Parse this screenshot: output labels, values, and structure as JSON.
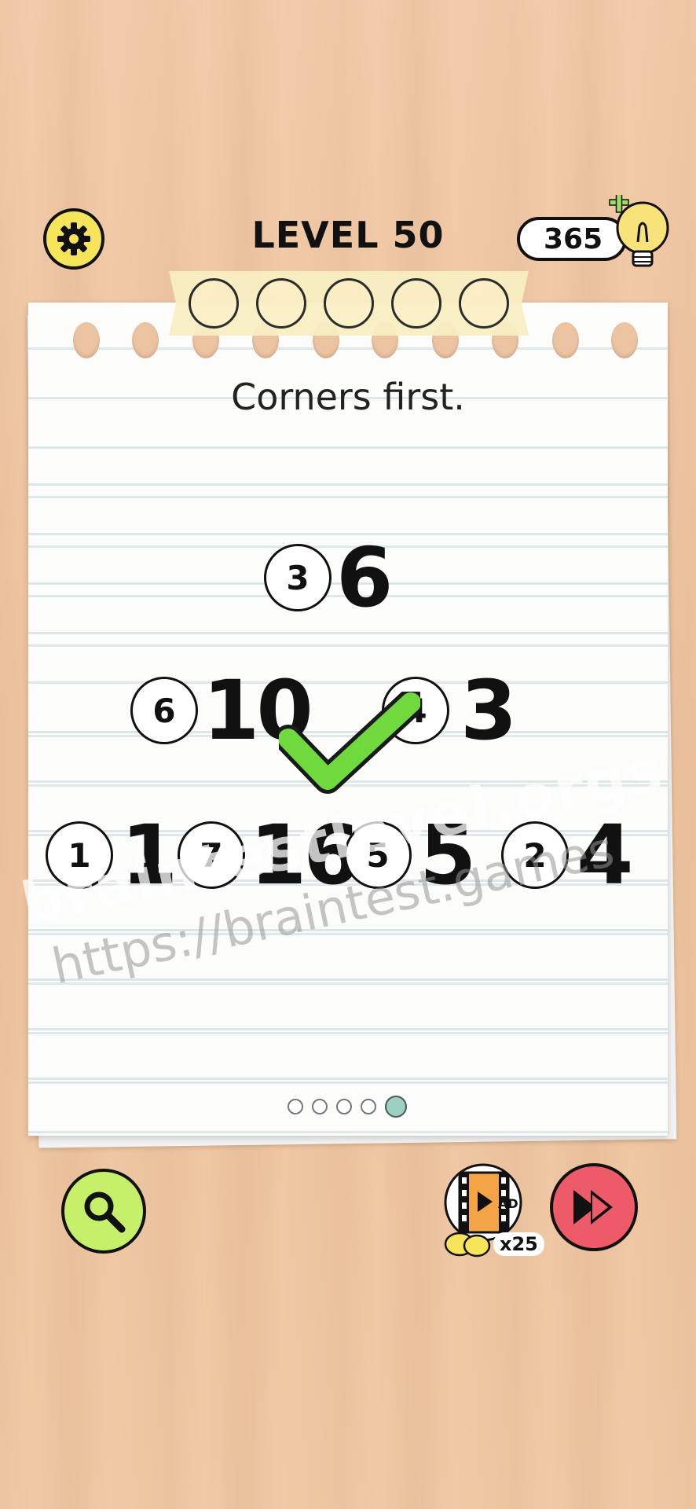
{
  "header": {
    "level_title": "LEVEL 50",
    "coins": "365"
  },
  "progress": {
    "total": 5,
    "filled": 0
  },
  "hint": "Corners first.",
  "puzzle": {
    "rows": [
      [
        {
          "order": "3",
          "number": "6"
        }
      ],
      [
        {
          "order": "6",
          "number": "10"
        },
        {
          "order": "4",
          "number": "3"
        }
      ],
      [
        {
          "order": "1",
          "number": "1"
        },
        {
          "order": "7",
          "number": "16"
        },
        {
          "order": "5",
          "number": "5"
        },
        {
          "order": "2",
          "number": "4"
        }
      ]
    ],
    "solved": true
  },
  "pagination": {
    "pages": 5,
    "current": 5
  },
  "watermarks": [
    "braintestlevel.orgs",
    "https://braintest.games"
  ],
  "ad": {
    "label": "AD",
    "reward": "x25"
  },
  "colors": {
    "settings": "#f6e45a",
    "search": "#c6f06a",
    "skip": "#ee5b68",
    "check": "#6fd93e",
    "active_dot": "#9bd1c2"
  },
  "icons": {
    "settings": "gear-icon",
    "hint_bulb": "lightbulb-plus-icon",
    "search": "magnifier-icon",
    "ad": "film-play-icon",
    "skip": "fast-forward-icon",
    "check": "checkmark-icon"
  }
}
